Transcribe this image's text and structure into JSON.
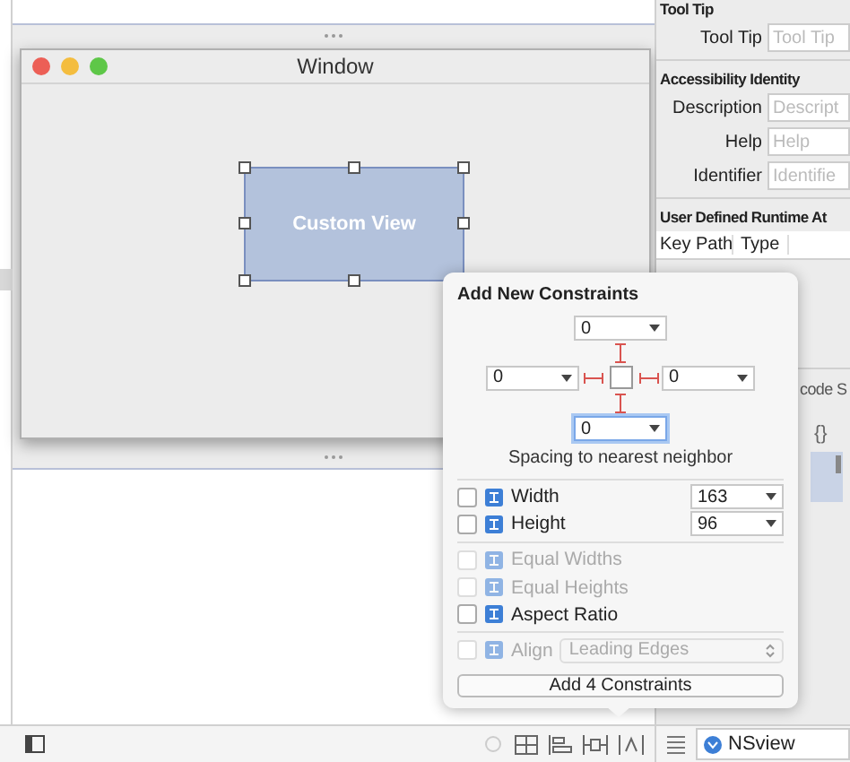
{
  "canvas": {
    "window": {
      "title": "Window",
      "view": {
        "label": "Custom View",
        "selected": true
      }
    }
  },
  "inspector": {
    "tool_tip": {
      "header": "Tool Tip",
      "label": "Tool Tip",
      "placeholder": "Tool Tip"
    },
    "accessibility": {
      "header": "Accessibility Identity",
      "fields": [
        {
          "label": "Description",
          "placeholder": "Descript"
        },
        {
          "label": "Help",
          "placeholder": "Help"
        },
        {
          "label": "Identifier",
          "placeholder": "Identifie"
        }
      ]
    },
    "runtime": {
      "header": "User Defined Runtime At",
      "columns": [
        "Key Path",
        "Type"
      ]
    },
    "library": {
      "tab": "code S",
      "braces": "{}"
    }
  },
  "popover": {
    "title": "Add New Constraints",
    "spacing": {
      "top": {
        "value": "0",
        "pinned": true,
        "focused": false
      },
      "left": {
        "value": "0",
        "pinned": true,
        "focused": false
      },
      "right": {
        "value": "0",
        "pinned": true,
        "focused": false
      },
      "bottom": {
        "value": "0",
        "pinned": true,
        "focused": true
      }
    },
    "spacing_label": "Spacing to nearest neighbor",
    "size_rows": [
      {
        "label": "Width",
        "value": "163",
        "checked": false
      },
      {
        "label": "Height",
        "value": "96",
        "checked": false
      }
    ],
    "options": [
      {
        "label": "Equal Widths",
        "checked": false,
        "disabled": true
      },
      {
        "label": "Equal Heights",
        "checked": false,
        "disabled": true
      },
      {
        "label": "Aspect Ratio",
        "checked": false,
        "disabled": false
      }
    ],
    "align": {
      "label": "Align",
      "value": "Leading Edges",
      "checked": false,
      "disabled": true
    },
    "button": "Add 4 Constraints"
  },
  "bottom_bar": {
    "object": "NSview"
  }
}
